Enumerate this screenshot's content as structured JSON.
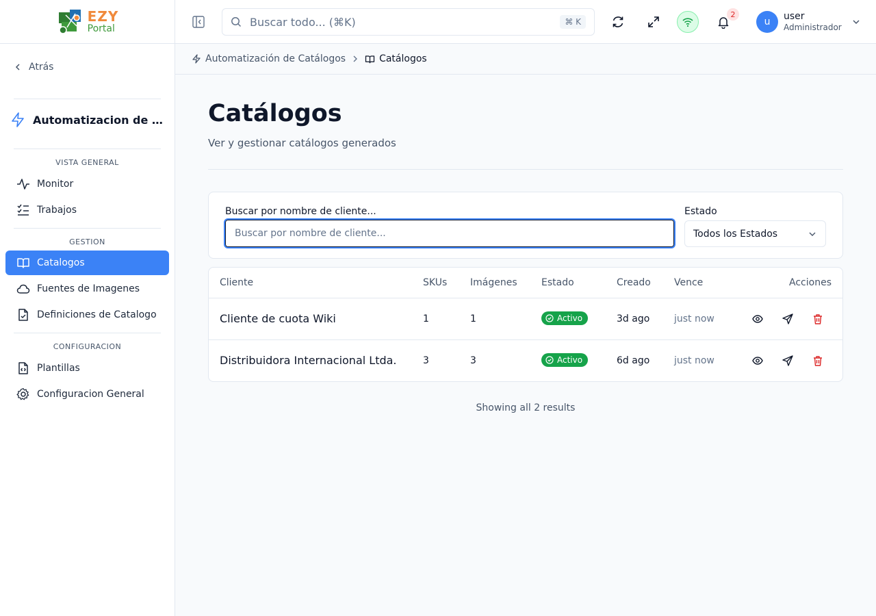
{
  "brand": {
    "ezy": "EZY",
    "portal": "Portal"
  },
  "sidebar": {
    "back_label": "Atrás",
    "module_title": "Automatizacion de Cat...",
    "sections": [
      {
        "label": "VISTA GENERAL",
        "items": [
          {
            "label": "Monitor",
            "icon": "activity-icon"
          },
          {
            "label": "Trabajos",
            "icon": "list-checks-icon"
          }
        ]
      },
      {
        "label": "GESTION",
        "items": [
          {
            "label": "Catalogos",
            "icon": "book-open-icon",
            "active": true
          },
          {
            "label": "Fuentes de Imagenes",
            "icon": "cloud-icon"
          },
          {
            "label": "Definiciones de Catalogo",
            "icon": "file-check-icon"
          }
        ]
      },
      {
        "label": "CONFIGURACION",
        "items": [
          {
            "label": "Plantillas",
            "icon": "file-code-icon"
          },
          {
            "label": "Configuracion General",
            "icon": "gear-icon"
          }
        ]
      }
    ]
  },
  "header": {
    "search_placeholder": "Buscar todo... (⌘K)",
    "search_shortcut": "⌘ K",
    "notifications_count": "2",
    "user_name": "user",
    "user_role": "Administrador",
    "avatar_initial": "u"
  },
  "breadcrumb": {
    "parent": "Automatización de Catálogos",
    "current": "Catálogos"
  },
  "page": {
    "title": "Catálogos",
    "subtitle": "Ver y gestionar catálogos generados"
  },
  "filters": {
    "search_label": "Buscar por nombre de cliente...",
    "search_placeholder": "Buscar por nombre de cliente...",
    "status_label": "Estado",
    "status_value": "Todos los Estados"
  },
  "table": {
    "headers": {
      "client": "Cliente",
      "skus": "SKUs",
      "images": "Imágenes",
      "status": "Estado",
      "created": "Creado",
      "expires": "Vence",
      "actions": "Acciones"
    },
    "rows": [
      {
        "client": "Cliente de cuota Wiki",
        "skus": "1",
        "images": "1",
        "status": "Activo",
        "created": "3d ago",
        "expires": "just now"
      },
      {
        "client": "Distribuidora Internacional Ltda.",
        "skus": "3",
        "images": "3",
        "status": "Activo",
        "created": "6d ago",
        "expires": "just now"
      }
    ]
  },
  "results_text": "Showing all 2 results",
  "colors": {
    "accent": "#3b82f6",
    "status_active": "#16a34a",
    "danger": "#dc2626",
    "logo_orange": "#f08a3c",
    "logo_green": "#3f9a3c"
  }
}
